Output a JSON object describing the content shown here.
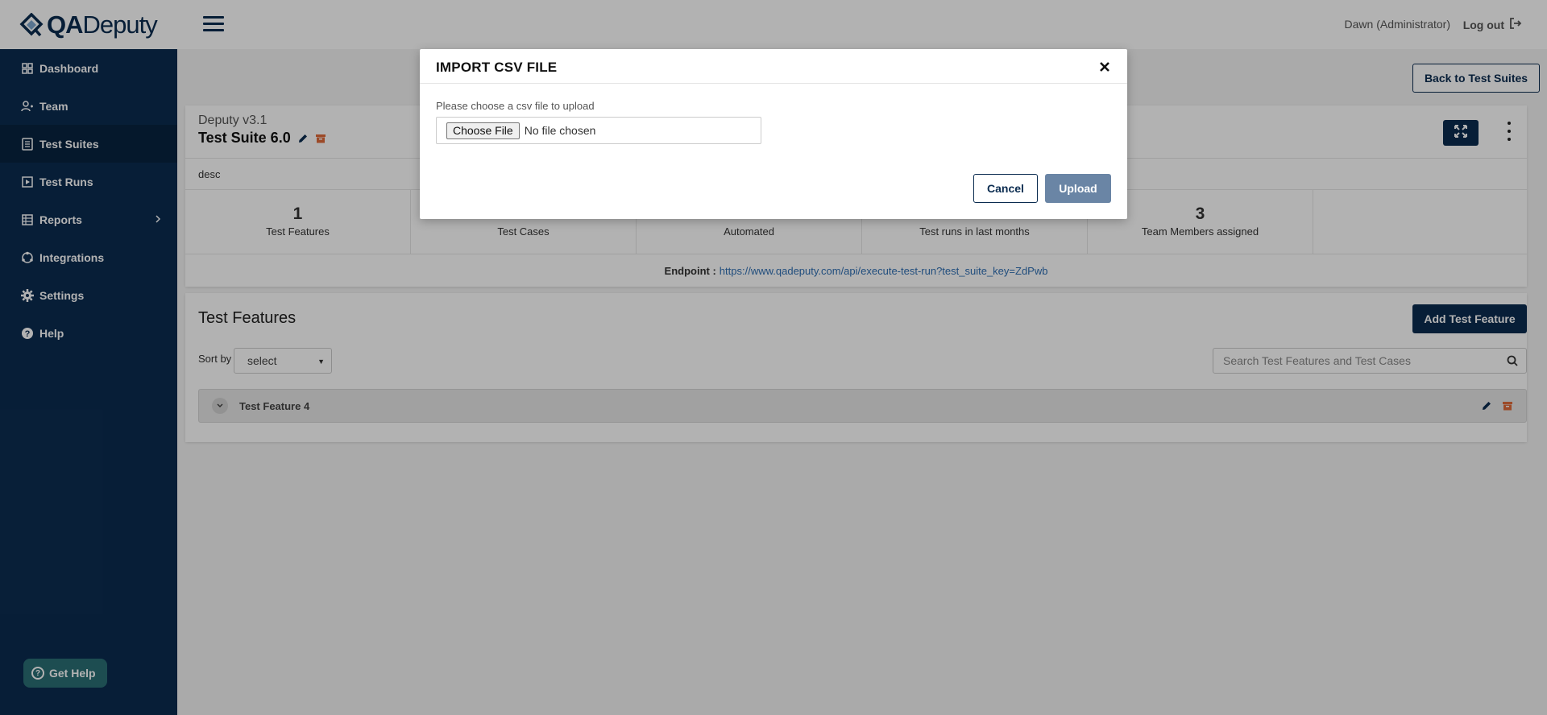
{
  "app": {
    "logo_primary": "QA",
    "logo_secondary": "Deputy"
  },
  "sidebar": {
    "items": [
      {
        "label": "Dashboard",
        "icon": "dashboard-icon"
      },
      {
        "label": "Team",
        "icon": "team-icon"
      },
      {
        "label": "Test Suites",
        "icon": "test-suites-icon",
        "active": true
      },
      {
        "label": "Test Runs",
        "icon": "test-runs-icon"
      },
      {
        "label": "Reports",
        "icon": "reports-icon",
        "has_submenu": true
      },
      {
        "label": "Integrations",
        "icon": "integrations-icon"
      },
      {
        "label": "Settings",
        "icon": "gear-icon"
      },
      {
        "label": "Help",
        "icon": "help-icon"
      }
    ],
    "get_help_label": "Get Help"
  },
  "topbar": {
    "user_name": "Dawn",
    "user_role": "(Administrator)",
    "logout_label": "Log out"
  },
  "main": {
    "back_button_label": "Back to Test Suites",
    "suite": {
      "project": "Deputy v3.1",
      "name": "Test Suite 6.0",
      "description": "desc",
      "stats": [
        {
          "value": "1",
          "label": "Test Features"
        },
        {
          "value": "",
          "label": "Test Cases"
        },
        {
          "value": "",
          "label": "Automated"
        },
        {
          "value": "",
          "label": "Test runs in last months"
        },
        {
          "value": "3",
          "label": "Team Members assigned"
        }
      ],
      "endpoint_label": "Endpoint :",
      "endpoint_url": "https://www.qadeputy.com/api/execute-test-run?test_suite_key=ZdPwb"
    },
    "features": {
      "title": "Test Features",
      "add_button_label": "Add Test Feature",
      "sort_label": "Sort by",
      "sort_value": "select",
      "search_placeholder": "Search Test Features and Test Cases",
      "items": [
        {
          "name": "Test Feature 4"
        }
      ]
    }
  },
  "modal": {
    "title": "IMPORT CSV FILE",
    "field_label": "Please choose a csv file to upload",
    "file_button_label": "Choose File",
    "file_status": "No file chosen",
    "cancel_label": "Cancel",
    "upload_label": "Upload"
  },
  "colors": {
    "navy": "#0b2c50",
    "accent_orange": "#e06b3a",
    "link_blue": "#2f6fb3",
    "upload_disabled": "#6a85a5",
    "get_help_teal": "#2a6f74"
  }
}
